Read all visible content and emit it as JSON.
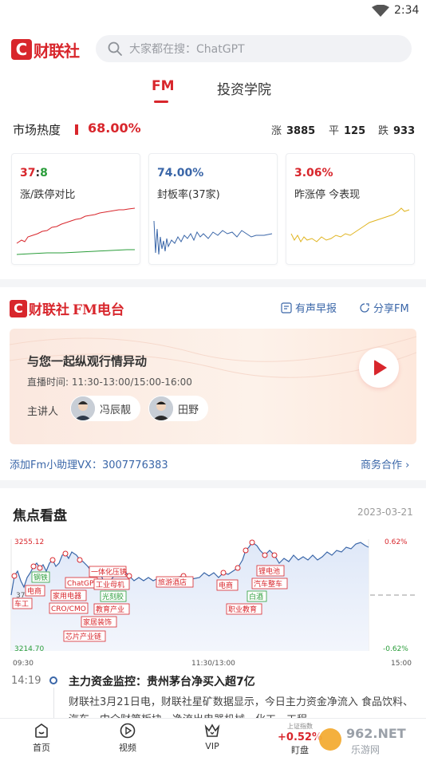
{
  "status_bar": {
    "time": "2:34"
  },
  "header": {
    "brand": "财联社",
    "search_placeholder": "大家都在搜：ChatGPT"
  },
  "tabs": [
    {
      "label": "FM"
    },
    {
      "label": "投资学院"
    }
  ],
  "market_heat": {
    "label": "市场热度",
    "value": "68.00%",
    "up_label": "涨",
    "up_count": "3885",
    "flat_label": "平",
    "flat_count": "125",
    "down_label": "跌",
    "down_count": "933"
  },
  "cards": [
    {
      "value_up": "37",
      "value_sep": ":",
      "value_down": "8",
      "title": "涨/跌停对比"
    },
    {
      "value": "74.00%",
      "title": "封板率(37家)"
    },
    {
      "value": "3.06%",
      "title": "昨涨停 今表现"
    }
  ],
  "fm": {
    "brand": "财联社",
    "brand_suffix": "FM电台",
    "link_early": "有声早报",
    "link_share": "分享FM",
    "headline": "与您一起纵观行情异动",
    "schedule": "直播时间: 11:30-13:00/15:00-16:00",
    "host_label": "主讲人",
    "hosts": [
      "冯辰靓",
      "田野"
    ]
  },
  "assistant": "添加Fm小助理VX：3007776383",
  "business": "商务合作 ›",
  "focus": {
    "title": "焦点看盘",
    "date": "2023-03-21",
    "chart": {
      "y_high": "3255.12",
      "y_low": "3214.70",
      "pct_high": "0.62%",
      "pct_low": "-0.62%",
      "x_start": "09:30",
      "x_mid": "11:30/13:00",
      "x_end": "15:00",
      "mid_label": "37",
      "tags": [
        "钢铁",
        "电商",
        "车工",
        "ChatGPT",
        "家用电器",
        "CRO/CMO",
        "一体化压铸",
        "工业母机",
        "光刻胶",
        "教育产业",
        "家居装饰",
        "芯片产业链",
        "旅游酒店",
        "电商",
        "锂电池",
        "汽车整车",
        "白酒",
        "职业教育"
      ]
    }
  },
  "news": {
    "time": "14:19",
    "title": "主力资金监控：贵州茅台净买入超7亿",
    "body": "财联社3月21日电，财联社星矿数据显示，今日主力资金净流入 食品饮料、汽车、中介财第板块，净流出电器机械、化工、工程"
  },
  "bottom_nav": {
    "home": "首页",
    "video": "视频",
    "vip": "VIP",
    "index_name": "上证指数",
    "index_value": "+0.52%",
    "index_label": "盯盘",
    "watermark": "962.NET 乐游网"
  }
}
